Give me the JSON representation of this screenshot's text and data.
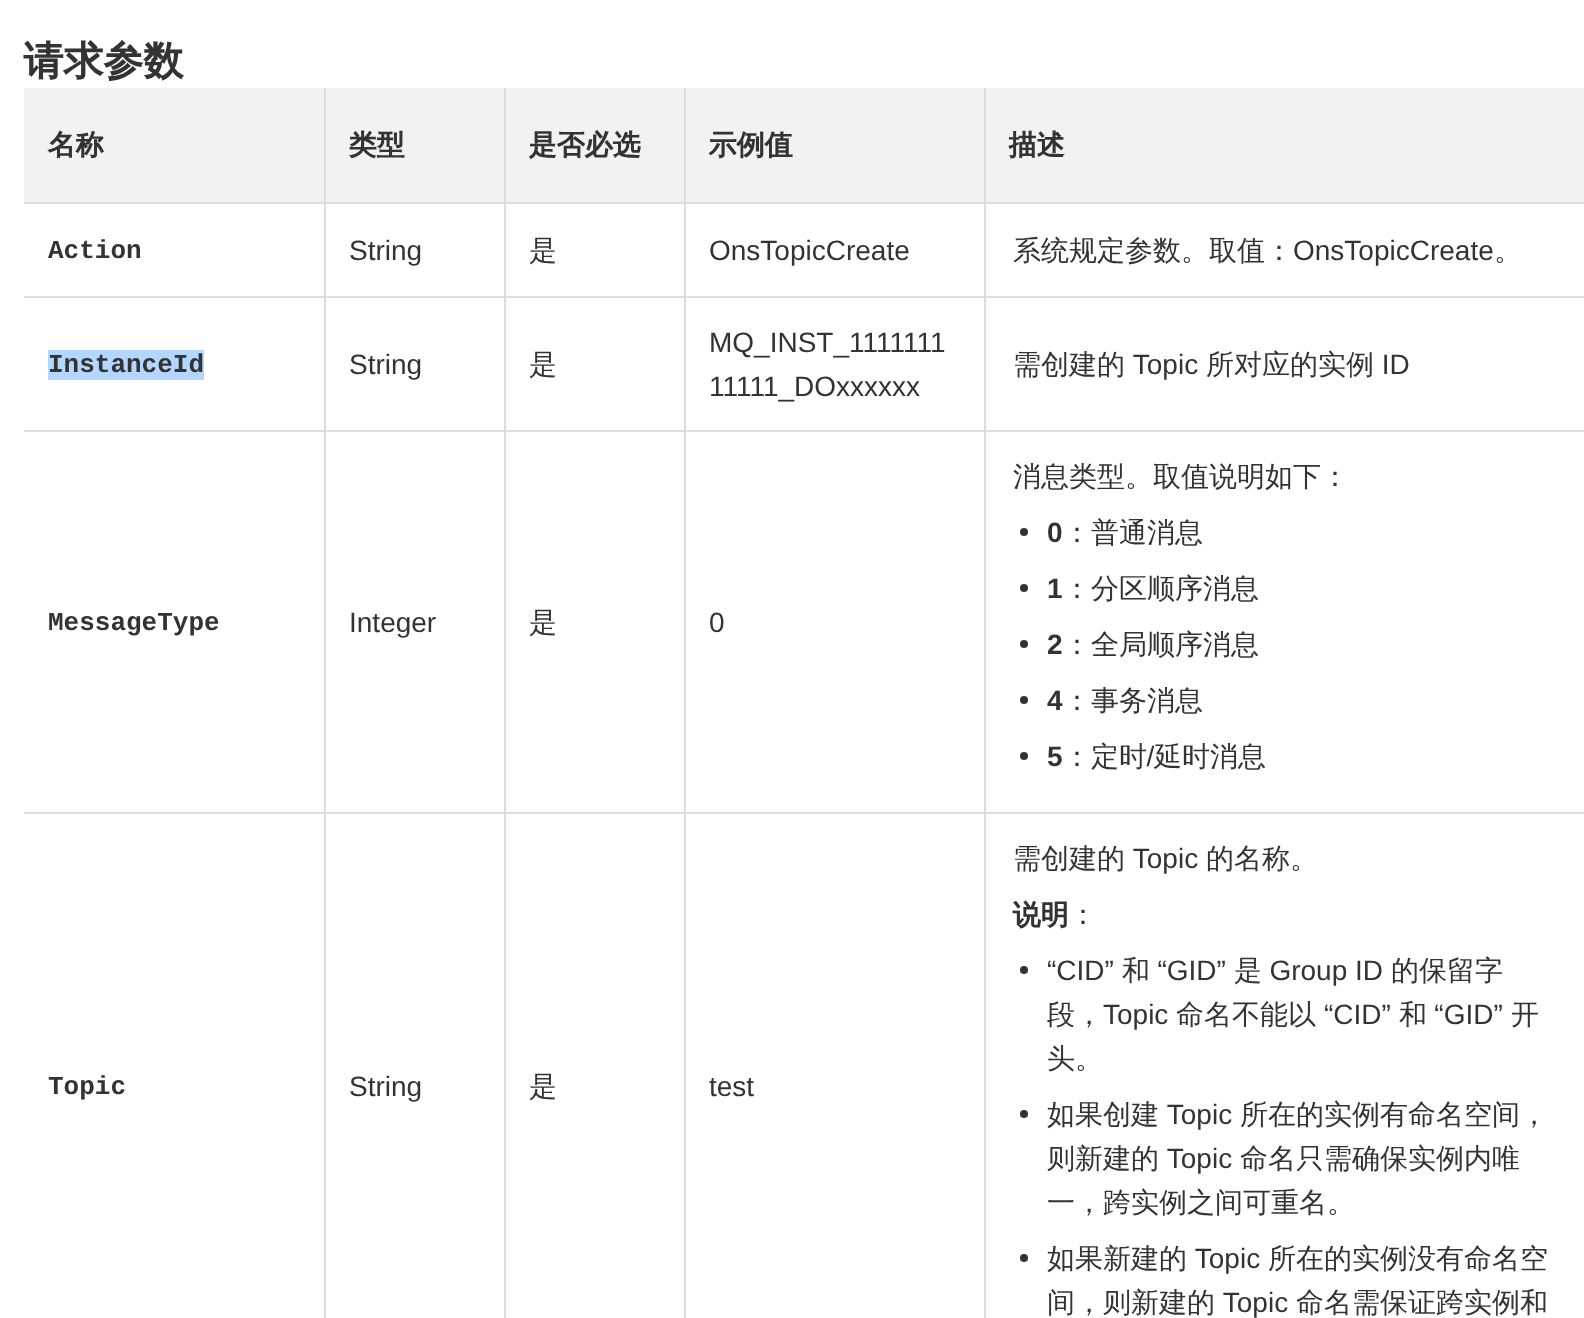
{
  "title": "请求参数",
  "table": {
    "columns": [
      "名称",
      "类型",
      "是否必选",
      "示例值",
      "描述"
    ],
    "rows": [
      {
        "name": "Action",
        "highlighted": false,
        "type": "String",
        "required": "是",
        "example": "OnsTopicCreate",
        "description": [
          {
            "kind": "text",
            "text": "系统规定参数。取值：OnsTopicCreate。"
          }
        ]
      },
      {
        "name": "InstanceId",
        "highlighted": true,
        "type": "String",
        "required": "是",
        "example": "MQ_INST_111111111111_DOxxxxxx",
        "description": [
          {
            "kind": "text",
            "text": "需创建的 Topic 所对应的实例 ID"
          }
        ]
      },
      {
        "name": "MessageType",
        "highlighted": false,
        "type": "Integer",
        "required": "是",
        "example": "0",
        "description": [
          {
            "kind": "text",
            "text": "消息类型。取值说明如下："
          },
          {
            "kind": "bullet",
            "text": "**0**：普通消息"
          },
          {
            "kind": "bullet",
            "text": "**1**：分区顺序消息"
          },
          {
            "kind": "bullet",
            "text": "**2**：全局顺序消息"
          },
          {
            "kind": "bullet",
            "text": "**4**：事务消息"
          },
          {
            "kind": "bullet",
            "text": "**5**：定时/延时消息"
          }
        ]
      },
      {
        "name": "Topic",
        "highlighted": false,
        "type": "String",
        "required": "是",
        "example": "test",
        "description": [
          {
            "kind": "text",
            "text": "需创建的 Topic 的名称。"
          },
          {
            "kind": "text",
            "text": "**说明**："
          },
          {
            "kind": "bullet",
            "text": "“CID” 和 “GID” 是 Group ID 的保留字段，Topic 命名不能以 “CID” 和 “GID” 开头。"
          },
          {
            "kind": "bullet",
            "text": "如果创建 Topic 所在的实例有命名空间，则新建的 Topic 命名只需确保实例内唯一，跨实例之间可重名。"
          },
          {
            "kind": "bullet",
            "text": "如果新建的 Topic 所在的实例没有命名空间，则新建的 Topic 命名需保证跨实例和"
          }
        ]
      }
    ]
  }
}
